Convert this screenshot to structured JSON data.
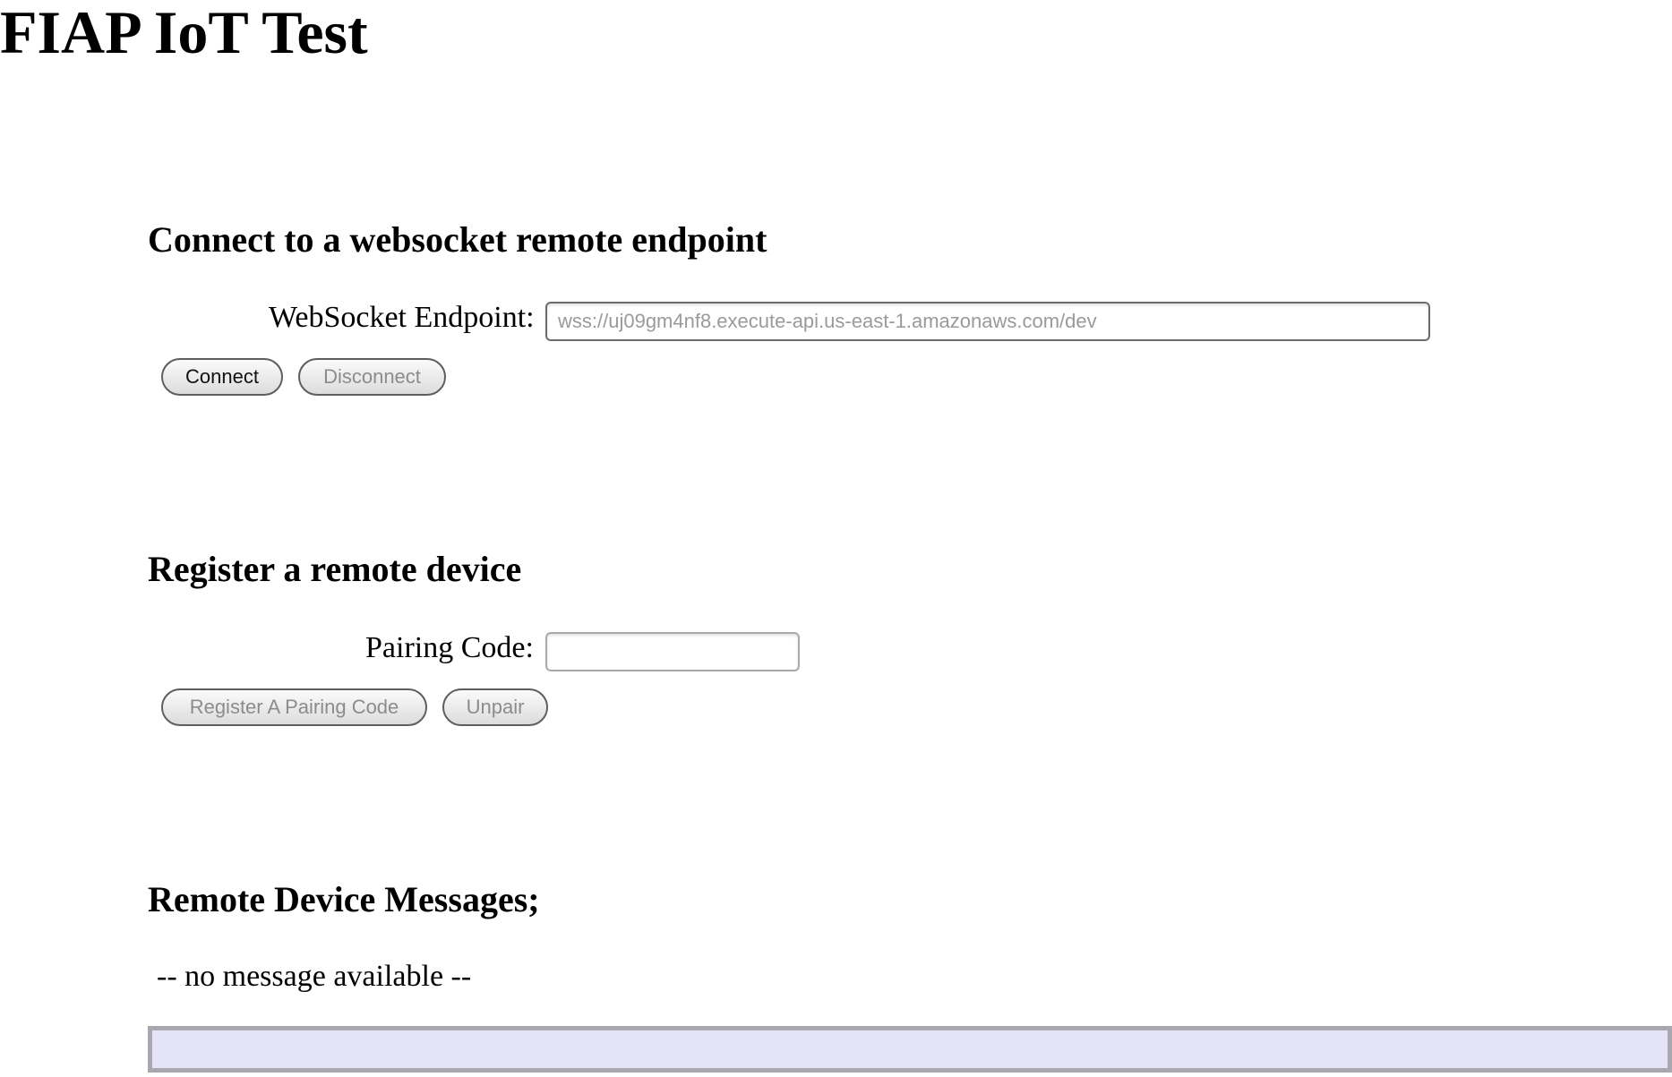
{
  "page": {
    "title": "FIAP IoT Test"
  },
  "connect_section": {
    "heading": "Connect to a websocket remote endpoint",
    "endpoint_label": "WebSocket Endpoint:",
    "endpoint_value": "",
    "endpoint_placeholder": "wss://uj09gm4nf8.execute-api.us-east-1.amazonaws.com/dev",
    "connect_label": "Connect",
    "disconnect_label": "Disconnect"
  },
  "register_section": {
    "heading": "Register a remote device",
    "pairing_label": "Pairing Code:",
    "pairing_value": "",
    "register_label": "Register A Pairing Code",
    "unpair_label": "Unpair"
  },
  "messages_section": {
    "heading": "Remote Device Messages;",
    "status": "-- no message available --"
  },
  "colors": {
    "message_box_background": "#e4e4f8",
    "message_box_border": "#a8a8ae",
    "disabled_text": "#8c8c8c"
  }
}
